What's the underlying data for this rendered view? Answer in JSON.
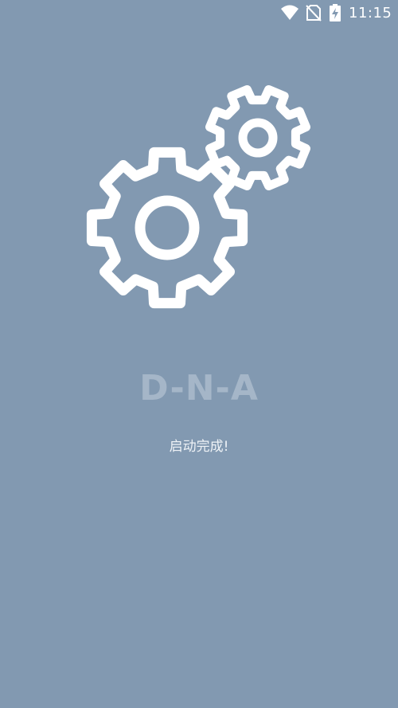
{
  "status_bar": {
    "time": "11:15",
    "icons": [
      "wifi-icon",
      "no-sim-icon",
      "battery-charging-icon"
    ]
  },
  "splash": {
    "app_name": "D-N-A",
    "message": "启动完成!",
    "illustration": "gears-icon"
  },
  "colors": {
    "background": "#8299b1",
    "app_name": "#a5b6c8",
    "message": "#eef2f6",
    "icon": "#ffffff"
  }
}
